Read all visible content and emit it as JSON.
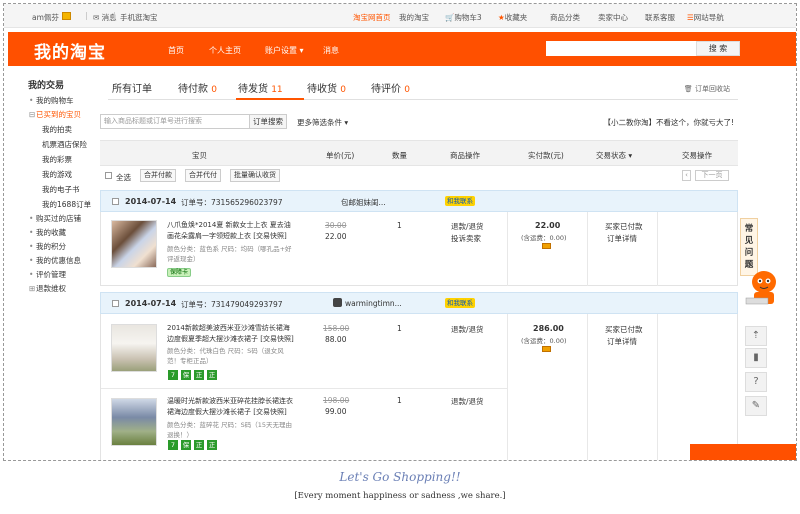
{
  "topbar": {
    "user": "am佩芬",
    "messages": "消息",
    "mobile": "手机逛淘宝",
    "right_items": [
      "淘宝网首页",
      "我的淘宝",
      "购物车3",
      "收藏夹",
      "商品分类",
      "卖家中心",
      "联系客服",
      "网站导航"
    ]
  },
  "header": {
    "logo": "我的淘宝",
    "nav": [
      "首页",
      "个人主页",
      "账户设置",
      "消息"
    ],
    "search_button": "搜 索"
  },
  "sidebar": {
    "title": "我的交易",
    "items_top": [
      "我的购物车",
      "已买到的宝贝"
    ],
    "sub_items": [
      "我的拍卖",
      "机票酒店保险",
      "我的彩票",
      "我的游戏",
      "我的电子书",
      "我的1688订单"
    ],
    "items_bottom": [
      "购买过的店铺",
      "我的收藏",
      "我的积分",
      "我的优惠信息",
      "评价管理",
      "退款维权"
    ]
  },
  "tabs": [
    {
      "label": "所有订单",
      "count": ""
    },
    {
      "label": "待付款",
      "count": "0"
    },
    {
      "label": "待发货",
      "count": "11"
    },
    {
      "label": "待收货",
      "count": "0"
    },
    {
      "label": "待评价",
      "count": "0"
    }
  ],
  "recycle": "订单回收站",
  "filter": {
    "placeholder": "输入商品标题或订单号进行搜索",
    "search_button": "订单搜索",
    "more": "更多筛选条件",
    "promo": "【小二教你淘】不看这个，你就亏大了!"
  },
  "table_headers": [
    "宝贝",
    "单价(元)",
    "数量",
    "商品操作",
    "实付款(元)",
    "交易状态",
    "交易操作"
  ],
  "bulk": {
    "select_all": "全选",
    "merge_pay": "合并付款",
    "merge_proxy": "合并代付",
    "batch_confirm": "批量确认收货",
    "next_page": "下一页"
  },
  "orders": [
    {
      "date": "2014-07-14",
      "order_no": "订单号：731565296023797",
      "shop": "包邮姐妹闺...",
      "contact": "和我联系",
      "items": [
        {
          "title": "八爪鱼焕*2014夏 新款女士上衣 夏去油画花朵露肩一字领短款上衣 [交易快照]",
          "spec": "颜色分类：蓝色系 尺码：均码（哪孔品+好评返现金）",
          "price_old": "30.00",
          "price": "22.00",
          "qty": "1",
          "ops": [
            "退款/退货",
            "投诉卖家"
          ],
          "sold_tag": "保障卡"
        }
      ],
      "paid": "22.00",
      "shipping": "(含运费：0.00)",
      "status": [
        "买家已付款",
        "订单详情"
      ]
    },
    {
      "date": "2014-07-14",
      "order_no": "订单号：731479049293797",
      "shop": "warmingtimn...",
      "contact": "和我联系",
      "items": [
        {
          "title": "2014新款超美波西米亚沙滩雪纺长裙海边度假夏季超大摆沙滩衣裙子 [交易快照]",
          "spec": "颜色分类：代珠白色 尺码：S码（退女风范！专柜正品）",
          "price_old": "158.00",
          "price": "88.00",
          "qty": "1",
          "ops": [
            "退款/退货"
          ]
        },
        {
          "title": "温暖时光新款波西米亚碎花挂脖长裙连衣裙海边度假大摆沙滩长裙子 [交易快照]",
          "spec": "颜色分类：蓝碎花 尺码：S码（15天无理由退换！）",
          "price_old": "198.00",
          "price": "99.00",
          "qty": "1",
          "ops": [
            "退款/退货"
          ]
        }
      ],
      "paid": "286.00",
      "shipping": "(含运费：0.00)",
      "status": [
        "买家已付款",
        "订单详情"
      ]
    }
  ],
  "badges": [
    "7",
    "保",
    "正",
    "正"
  ],
  "help_tab": "常见问题",
  "footer": {
    "title": "Let's Go Shopping!!",
    "subtitle": "[Every moment happiness or sadness ,we share.]"
  }
}
